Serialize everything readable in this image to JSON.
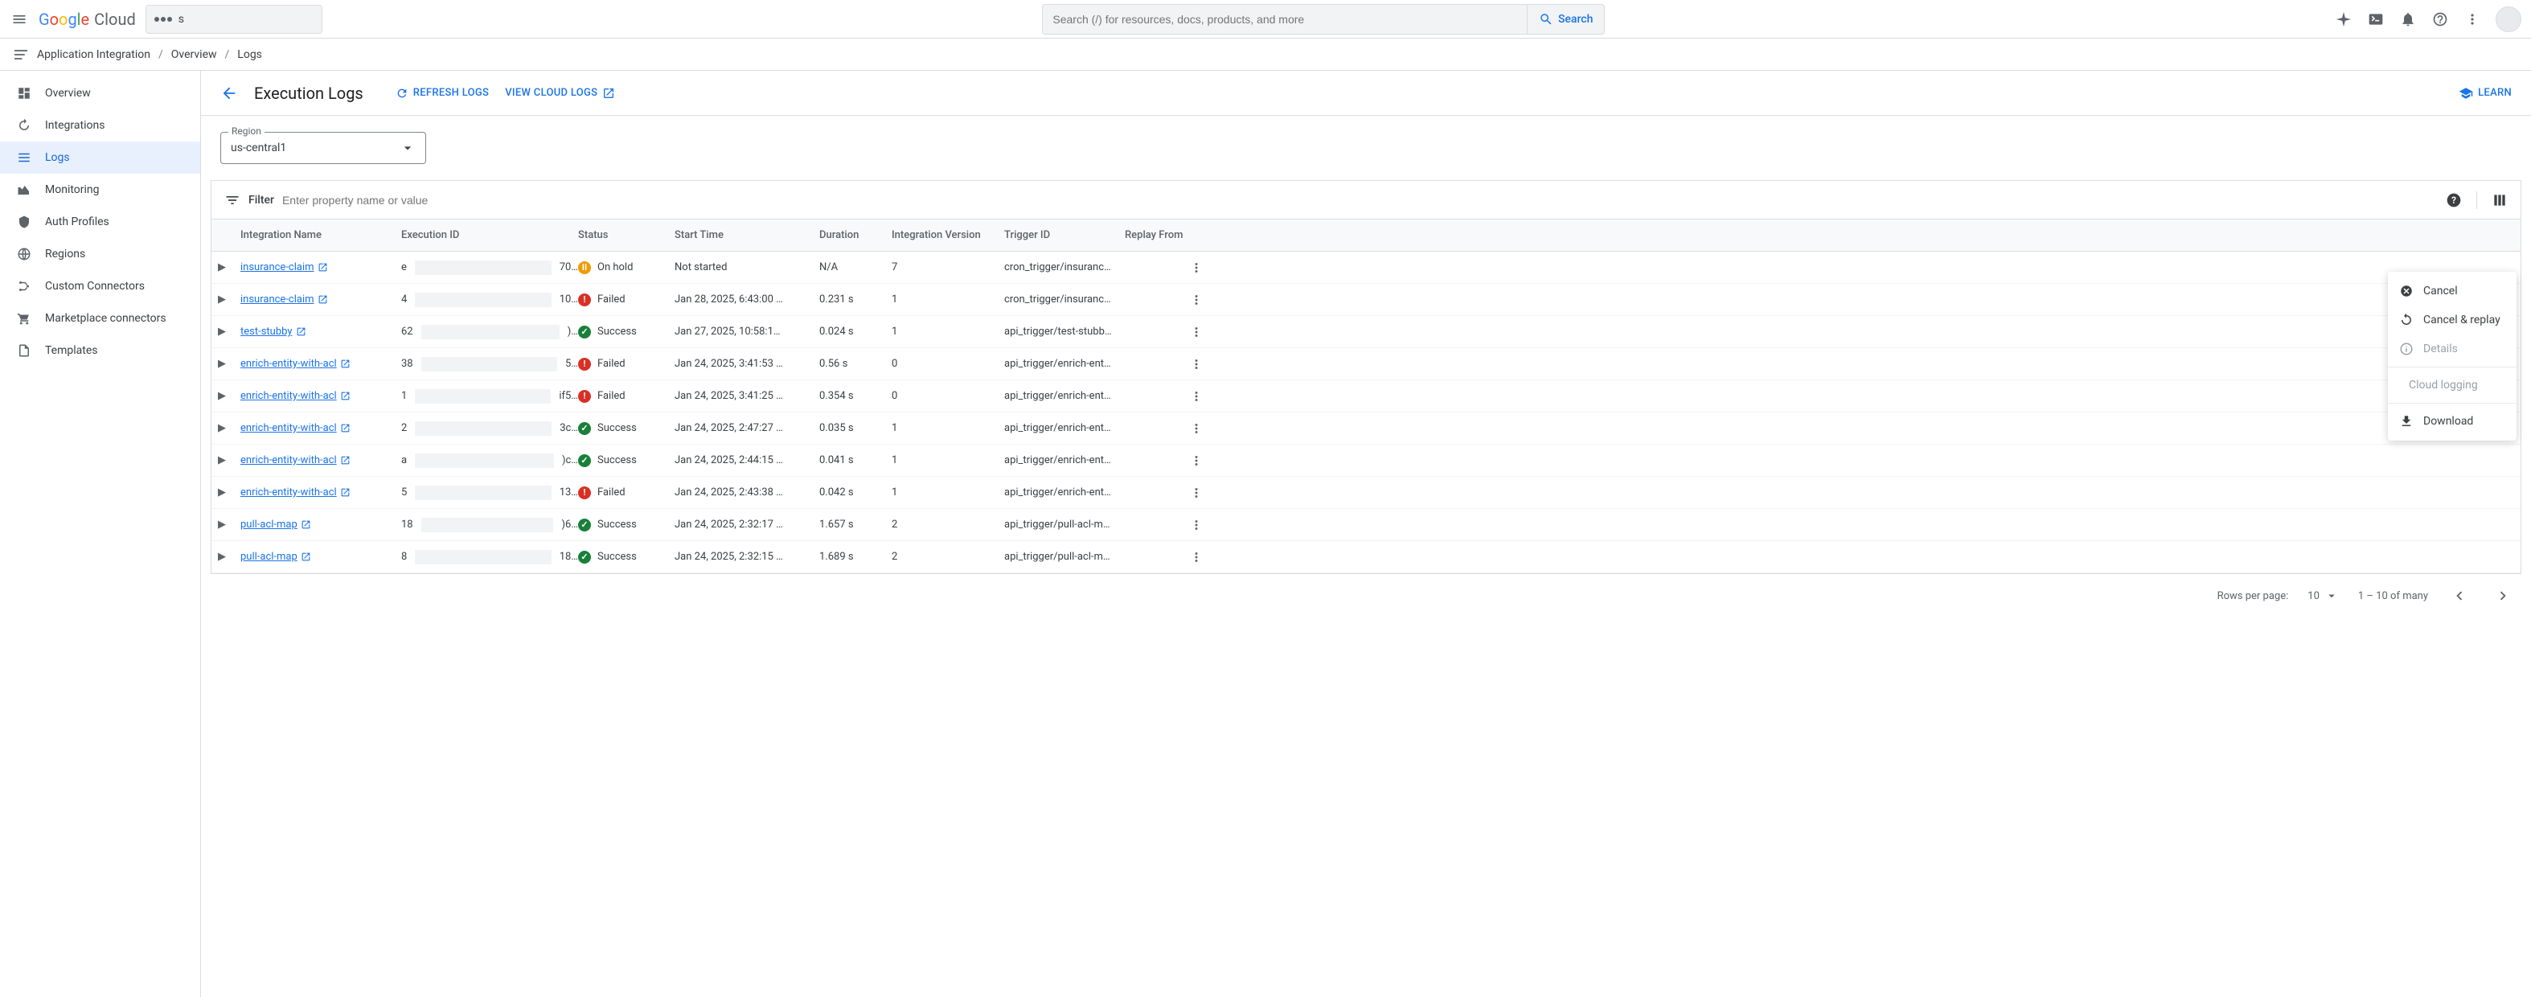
{
  "header": {
    "logo_cloud_text": "Cloud",
    "project_name": "s",
    "search_placeholder": "Search (/) for resources, docs, products, and more",
    "search_button": "Search"
  },
  "breadcrumb": {
    "service": "Application Integration",
    "items": [
      "Overview",
      "Logs"
    ]
  },
  "sidebar": {
    "items": [
      {
        "label": "Overview",
        "icon": "dashboard"
      },
      {
        "label": "Integrations",
        "icon": "arrow-circle"
      },
      {
        "label": "Logs",
        "icon": "list",
        "selected": true
      },
      {
        "label": "Monitoring",
        "icon": "chart"
      },
      {
        "label": "Auth Profiles",
        "icon": "shield"
      },
      {
        "label": "Regions",
        "icon": "globe"
      },
      {
        "label": "Custom Connectors",
        "icon": "branch"
      },
      {
        "label": "Marketplace connectors",
        "icon": "cart"
      },
      {
        "label": "Templates",
        "icon": "doc"
      }
    ]
  },
  "page": {
    "title": "Execution Logs",
    "refresh": "REFRESH LOGS",
    "view_cloud_logs": "VIEW CLOUD LOGS",
    "learn": "LEARN",
    "region_label": "Region",
    "region_value": "us-central1",
    "filter_label": "Filter",
    "filter_placeholder": "Enter property name or value"
  },
  "table": {
    "headers": [
      "Integration Name",
      "Execution ID",
      "Status",
      "Start Time",
      "Duration",
      "Integration Version",
      "Trigger ID",
      "Replay From"
    ],
    "rows": [
      {
        "name": "insurance-claim",
        "exec_start": "e",
        "exec_end": "70…",
        "status": "On hold",
        "status_type": "onhold",
        "start": "Not started",
        "duration": "N/A",
        "version": "7",
        "trigger": "cron_trigger/insuranc…"
      },
      {
        "name": "insurance-claim",
        "exec_start": "4",
        "exec_end": "10…",
        "status": "Failed",
        "status_type": "failed",
        "start": "Jan 28, 2025, 6:43:00 …",
        "duration": "0.231 s",
        "version": "1",
        "trigger": "cron_trigger/insuranc…"
      },
      {
        "name": "test-stubby",
        "exec_start": "62",
        "exec_end": ")…",
        "status": "Success",
        "status_type": "success",
        "start": "Jan 27, 2025, 10:58:1…",
        "duration": "0.024 s",
        "version": "1",
        "trigger": "api_trigger/test-stubb…"
      },
      {
        "name": "enrich-entity-with-acl",
        "exec_start": "38",
        "exec_end": "5…",
        "status": "Failed",
        "status_type": "failed",
        "start": "Jan 24, 2025, 3:41:53 …",
        "duration": "0.56 s",
        "version": "0",
        "trigger": "api_trigger/enrich-ent…"
      },
      {
        "name": "enrich-entity-with-acl",
        "exec_start": "1",
        "exec_end": "if5…",
        "status": "Failed",
        "status_type": "failed",
        "start": "Jan 24, 2025, 3:41:25 …",
        "duration": "0.354 s",
        "version": "0",
        "trigger": "api_trigger/enrich-ent…"
      },
      {
        "name": "enrich-entity-with-acl",
        "exec_start": "2",
        "exec_end": "3c…",
        "status": "Success",
        "status_type": "success",
        "start": "Jan 24, 2025, 2:47:27 …",
        "duration": "0.035 s",
        "version": "1",
        "trigger": "api_trigger/enrich-ent…"
      },
      {
        "name": "enrich-entity-with-acl",
        "exec_start": "a",
        "exec_end": ")c…",
        "status": "Success",
        "status_type": "success",
        "start": "Jan 24, 2025, 2:44:15 …",
        "duration": "0.041 s",
        "version": "1",
        "trigger": "api_trigger/enrich-ent…"
      },
      {
        "name": "enrich-entity-with-acl",
        "exec_start": "5",
        "exec_end": "13…",
        "status": "Failed",
        "status_type": "failed",
        "start": "Jan 24, 2025, 2:43:38 …",
        "duration": "0.042 s",
        "version": "1",
        "trigger": "api_trigger/enrich-ent…"
      },
      {
        "name": "pull-acl-map",
        "exec_start": "18",
        "exec_end": ")6…",
        "status": "Success",
        "status_type": "success",
        "start": "Jan 24, 2025, 2:32:17 …",
        "duration": "1.657 s",
        "version": "2",
        "trigger": "api_trigger/pull-acl-m…"
      },
      {
        "name": "pull-acl-map",
        "exec_start": "8",
        "exec_end": "18…",
        "status": "Success",
        "status_type": "success",
        "start": "Jan 24, 2025, 2:32:15 …",
        "duration": "1.689 s",
        "version": "2",
        "trigger": "api_trigger/pull-acl-m…"
      }
    ]
  },
  "pagination": {
    "rows_per_page_label": "Rows per page:",
    "rows_per_page_value": "10",
    "range": "1 – 10 of many"
  },
  "context_menu": {
    "items": [
      {
        "label": "Cancel",
        "icon": "cancel",
        "disabled": false
      },
      {
        "label": "Cancel & replay",
        "icon": "replay",
        "disabled": false
      },
      {
        "label": "Details",
        "icon": "info",
        "disabled": true
      },
      {
        "divider": true
      },
      {
        "label": "Cloud logging",
        "icon": "",
        "disabled": true
      },
      {
        "divider": true
      },
      {
        "label": "Download",
        "icon": "download",
        "disabled": false
      }
    ]
  }
}
